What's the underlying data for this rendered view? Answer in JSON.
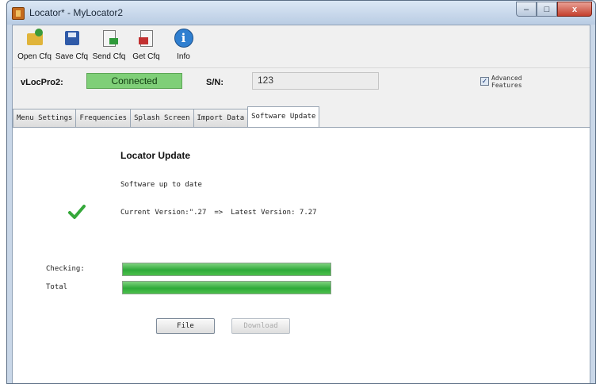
{
  "window": {
    "title": "Locator* - MyLocator2",
    "controls": {
      "minimize": "–",
      "maximize": "□",
      "close": "x"
    }
  },
  "toolbar": {
    "items": [
      {
        "label": "Open Cfq",
        "icon": "open-folder-icon"
      },
      {
        "label": "Save Cfq",
        "icon": "save-disk-icon"
      },
      {
        "label": "Send Cfq",
        "icon": "send-document-icon"
      },
      {
        "label": "Get Cfq",
        "icon": "get-document-icon"
      },
      {
        "label": "Info",
        "icon": "info-icon"
      }
    ]
  },
  "status": {
    "device_label": "vLocPro2:",
    "connection": "Connected",
    "connection_color": "#7fcf78",
    "sn_label": "S/N:",
    "sn_value": "123",
    "advanced_line1": "Advanced",
    "advanced_line2": "Features",
    "advanced_checked": true
  },
  "tabs": [
    {
      "label": "Menu Settings",
      "active": false
    },
    {
      "label": "Frequencies",
      "active": false
    },
    {
      "label": "Splash Screen",
      "active": false
    },
    {
      "label": "Import Data",
      "active": false
    },
    {
      "label": "Software Update",
      "active": true
    }
  ],
  "update": {
    "title": "Locator Update",
    "status_text": "Software up to date",
    "current_version": "Current Version:\".27",
    "arrow": "=>",
    "latest_version": "Latest Version: 7.27",
    "checking_label": "Checking:",
    "checking_progress": 1.0,
    "total_label": "Total",
    "total_progress": 1.0,
    "accent_color": "#2faa3a",
    "file_button": "File",
    "download_button": "Download"
  }
}
